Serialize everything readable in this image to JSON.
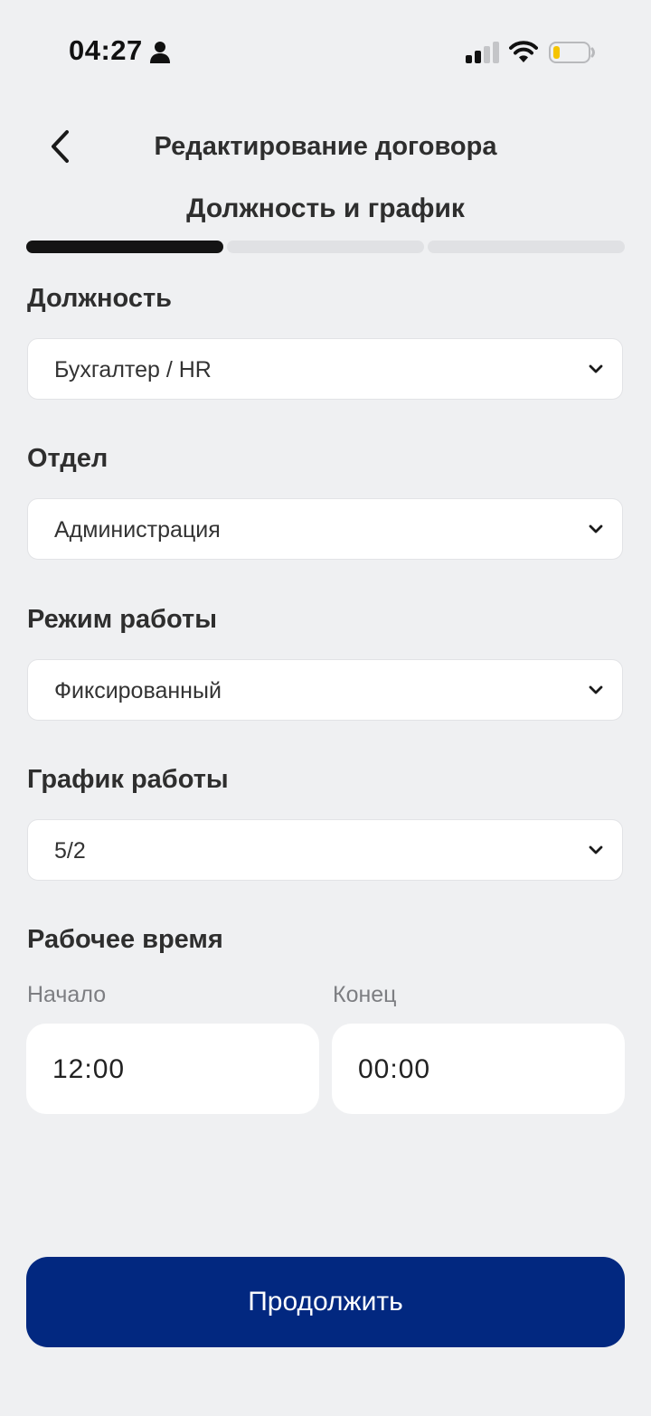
{
  "status_bar": {
    "time": "04:27"
  },
  "header": {
    "title": "Редактирование договора",
    "step_title": "Должность и график"
  },
  "progress": {
    "total_steps": 3,
    "current_step": 1
  },
  "fields": {
    "position": {
      "label": "Должность",
      "value": "Бухгалтер / HR"
    },
    "department": {
      "label": "Отдел",
      "value": "Администрация"
    },
    "work_mode": {
      "label": "Режим работы",
      "value": "Фиксированный"
    },
    "schedule": {
      "label": "График работы",
      "value": "5/2"
    },
    "work_time": {
      "label": "Рабочее время",
      "start_label": "Начало",
      "start_value": "12:00",
      "end_label": "Конец",
      "end_value": "00:00"
    }
  },
  "actions": {
    "continue_label": "Продолжить"
  },
  "colors": {
    "background": "#eff0f2",
    "primary_button": "#022880",
    "progress_active": "#141414",
    "progress_inactive": "#e0e1e4",
    "battery_level": "#f5c400"
  }
}
